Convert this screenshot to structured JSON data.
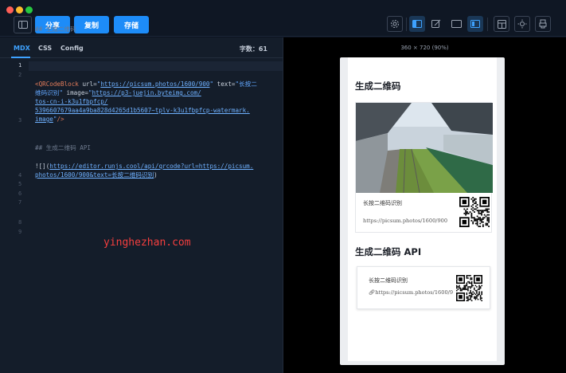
{
  "toolbar": {
    "share_label": "分享",
    "copy_label": "复制",
    "save_label": "存储"
  },
  "editor": {
    "tabs": [
      "MDX",
      "CSS",
      "Config"
    ],
    "active_tab": "MDX",
    "word_count": "字数：61",
    "lines": [
      {
        "n": "1",
        "text": "## 生成二维码"
      },
      {
        "n": "2",
        "text": ""
      },
      {
        "n": "3",
        "parts": [
          {
            "t": "<QRCodeBlock ",
            "c": "tag"
          },
          {
            "t": "url=",
            "c": "attr"
          },
          {
            "t": "\"",
            "c": "str"
          },
          {
            "t": "https://picsum.photos/1600/900",
            "c": "link"
          },
          {
            "t": "\" ",
            "c": "str"
          },
          {
            "t": "text=",
            "c": "attr"
          },
          {
            "t": "\"长按二",
            "c": "str"
          }
        ]
      },
      {
        "n": "",
        "parts": [
          {
            "t": "维码识别\" ",
            "c": "str"
          },
          {
            "t": "image=",
            "c": "attr"
          },
          {
            "t": "\"",
            "c": "str"
          },
          {
            "t": "https://p3-juejin.byteimg.com/",
            "c": "link"
          }
        ]
      },
      {
        "n": "",
        "parts": [
          {
            "t": "tos-cn-i-k3u1fbpfcp/",
            "c": "link"
          }
        ]
      },
      {
        "n": "",
        "parts": [
          {
            "t": "5396607679aa4a9ba828d4265d1b5607~tplv-k3u1fbpfcp-watermark.",
            "c": "link"
          }
        ]
      },
      {
        "n": "",
        "parts": [
          {
            "t": "image",
            "c": "link"
          },
          {
            "t": "\"",
            "c": "str"
          },
          {
            "t": "/>",
            "c": "tag"
          }
        ]
      },
      {
        "n": "4",
        "text": ""
      },
      {
        "n": "5",
        "text": "## 生成二维码 API"
      },
      {
        "n": "6",
        "text": ""
      },
      {
        "n": "7",
        "parts": [
          {
            "t": "![](",
            "c": "plain"
          },
          {
            "t": "https://editor.runjs.cool/api/qrcode?url=https://picsum.",
            "c": "link"
          }
        ]
      },
      {
        "n": "",
        "parts": [
          {
            "t": "photos/1600/900&text=长按二维码识别",
            "c": "link"
          },
          {
            "t": ")",
            "c": "plain"
          }
        ]
      },
      {
        "n": "8",
        "text": ""
      },
      {
        "n": "9",
        "text": ""
      }
    ]
  },
  "watermark": "yinghezhan.com",
  "preview": {
    "size_label": "360 × 720 (90%)",
    "heading1": "生成二维码",
    "card1_caption": "长按二维码识别",
    "card1_url": "https://picsum.photos/1600/900",
    "heading2": "生成二维码 API",
    "card2_caption": "长按二维码识别",
    "card2_url": "https://picsum.photos/1600/9"
  },
  "icons": {
    "sidebar_toggle": "sidebar-icon",
    "right_tools": [
      "settings-icon",
      "split-view-icon",
      "edit-icon",
      "preview-icon",
      "mobile-preview-icon",
      "template-icon",
      "theme-icon",
      "export-icon"
    ]
  },
  "colors": {
    "accent": "#1d8cf8",
    "watermark": "#f43e3e"
  }
}
